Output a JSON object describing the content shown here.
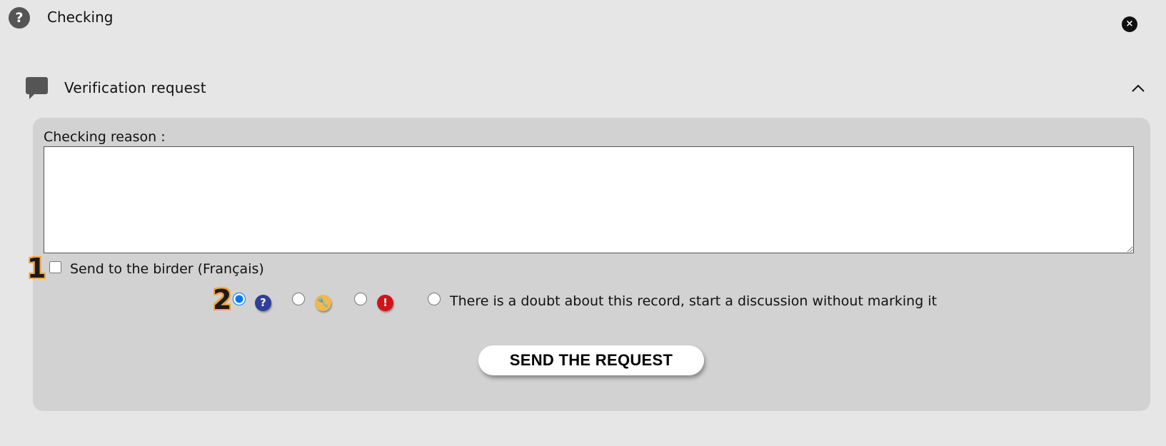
{
  "header": {
    "title": "Checking",
    "help_icon_glyph": "?",
    "close_icon_glyph": "×"
  },
  "section": {
    "title": "Verification request",
    "icon": "chat-bubble-icon",
    "expanded": true
  },
  "form": {
    "reason_label": "Checking reason :",
    "reason_value": "",
    "send_to_birder_label": "Send to the birder (Français)",
    "send_to_birder_checked": false,
    "step_markers": [
      "1",
      "2"
    ],
    "options": [
      {
        "icon": "question-icon",
        "glyph": "?",
        "color": "#2e3f98",
        "checked": true
      },
      {
        "icon": "wrench-icon",
        "glyph": "🔧",
        "color": "#f1b84a",
        "checked": false
      },
      {
        "icon": "alert-icon",
        "glyph": "!",
        "color": "#d0141a",
        "checked": false
      },
      {
        "icon": "none",
        "label": "There is a doubt about this record, start a discussion without marking it",
        "checked": false
      }
    ],
    "submit_label": "SEND THE REQUEST"
  }
}
